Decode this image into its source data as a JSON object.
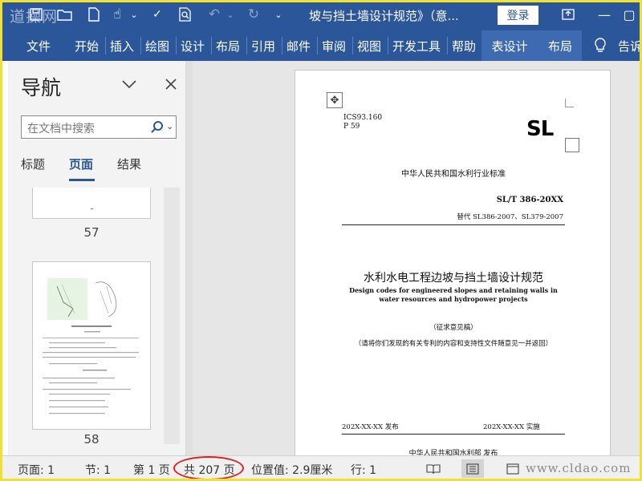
{
  "app": {
    "watermark": "道操网",
    "doc_title": "坡与挡土墙设计规范》（意...",
    "login_label": "登录"
  },
  "ribbon": {
    "tabs": [
      "文件",
      "开始",
      "插入",
      "绘图",
      "设计",
      "布局",
      "引用",
      "邮件",
      "审阅",
      "视图",
      "开发工具",
      "帮助"
    ],
    "context_tabs": [
      "表设计",
      "布局"
    ],
    "tell_me": "告诉"
  },
  "nav": {
    "title": "导航",
    "search_placeholder": "在文档中搜索",
    "tabs": [
      "标题",
      "页面",
      "结果"
    ],
    "active_tab": "页面",
    "thumbnails": [
      {
        "page": "57"
      },
      {
        "page": "58"
      }
    ]
  },
  "document": {
    "ics_line1": "ICS93.160",
    "ics_line2": "P 59",
    "logo": "SL",
    "standard_name": "中华人民共和国水利行业标准",
    "standard_code": "SL/T 386-20XX",
    "replaces": "替代 SL386-2007、SL379-2007",
    "title_cn": "水利水电工程边坡与挡土墙设计规范",
    "title_en": "Design codes for engineered slopes and retaining walls in water resources and hydropower projects",
    "draft_label": "（征求意见稿）",
    "note": "（请将你们发现的有关专利的内容和支持性文件随意见一并返回）",
    "publish_date": "202X-XX-XX  发布",
    "implement_date": "202X-XX-XX   实施",
    "publisher": "中华人民共和国水利部    发布"
  },
  "status": {
    "page": "页面: 1",
    "section": "节: 1",
    "page_of": "第 1 页",
    "total": "共 207 页",
    "position": "位置值: 2.9厘米",
    "line": "行: 1",
    "footer_watermark": "www.cldao.com"
  },
  "colors": {
    "accent": "#2b579a",
    "highlight": "#e02020",
    "frame": "#f0e030"
  }
}
